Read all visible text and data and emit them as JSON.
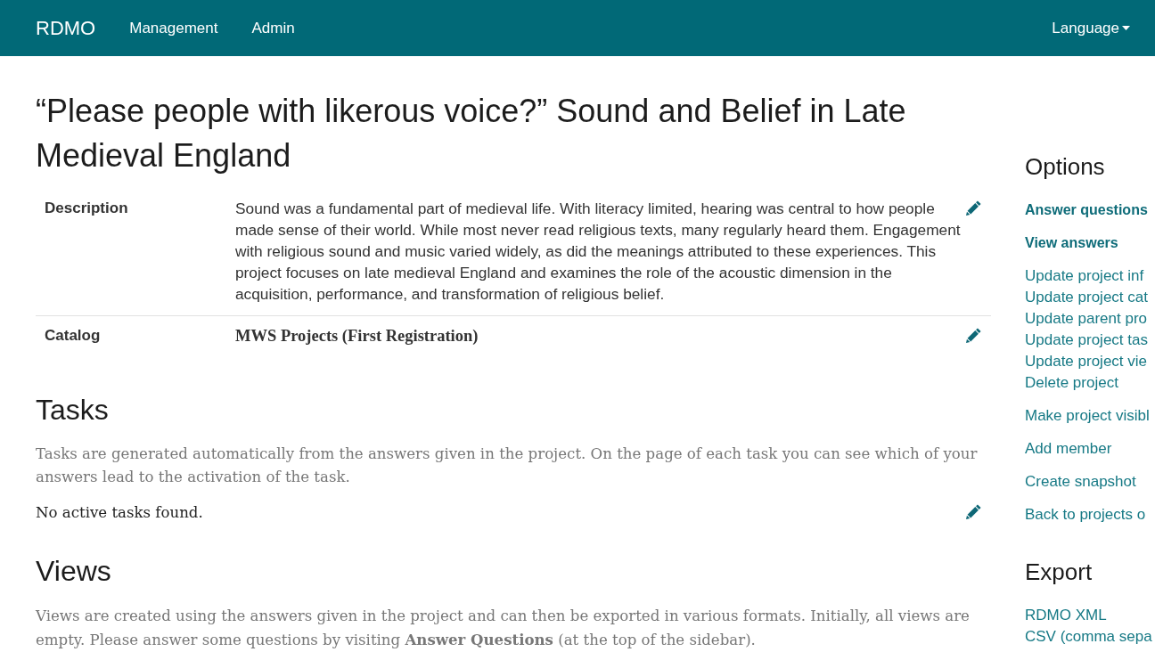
{
  "navbar": {
    "brand": "RDMO",
    "items": [
      {
        "label": "Management"
      },
      {
        "label": "Admin"
      }
    ],
    "language": {
      "label": "Language"
    }
  },
  "project": {
    "title": "“Please people with likerous voice?” Sound and Belief in Late Medieval England",
    "fields": [
      {
        "kind": "text",
        "label": "Description",
        "value": "Sound was a fundamental part of medieval life. With literacy limited, hearing was central to how people made sense of their world. While most never read religious texts, many regularly heard them. Engagement with religious sound and music varied widely, as did the meanings attributed to these experiences. This project focuses on late medieval England and examines the role of the acoustic dimension in the acquisition, performance, and transformation of religious belief."
      },
      {
        "kind": "catalog",
        "label": "Catalog",
        "value": "MWS Projects (First Registration)"
      }
    ]
  },
  "tasks": {
    "heading": "Tasks",
    "help": "Tasks are generated automatically from the answers given in the project. On the page of each task you can see which of your answers lead to the activation of the task.",
    "empty": "No active tasks found."
  },
  "views": {
    "heading": "Views",
    "help": "Views are created using the answers given in the project and can then be exported in various formats. Initially, all views are empty. Please answer some questions by visiting **Answer Questions** (at the top of the sidebar)."
  },
  "sidebar": {
    "sections": [
      {
        "heading": "Options",
        "groups": [
          {
            "kind": "primary",
            "items": [
              "Answer questions"
            ]
          },
          {
            "kind": "primary",
            "items": [
              "View answers"
            ]
          },
          {
            "kind": "plain",
            "items": [
              "Update project inf",
              "Update project cat",
              "Update parent pro",
              "Update project tas",
              "Update project vie",
              "Delete project"
            ]
          },
          {
            "kind": "plain",
            "items": [
              "Make project visibl"
            ]
          },
          {
            "kind": "plain",
            "items": [
              "Add member"
            ]
          },
          {
            "kind": "plain",
            "items": [
              "Create snapshot"
            ]
          },
          {
            "kind": "plain",
            "items": [
              "Back to projects o"
            ]
          }
        ]
      },
      {
        "heading": "Export",
        "groups": [
          {
            "kind": "plain",
            "items": [
              "RDMO XML",
              "CSV (comma sepa"
            ]
          }
        ]
      }
    ]
  }
}
